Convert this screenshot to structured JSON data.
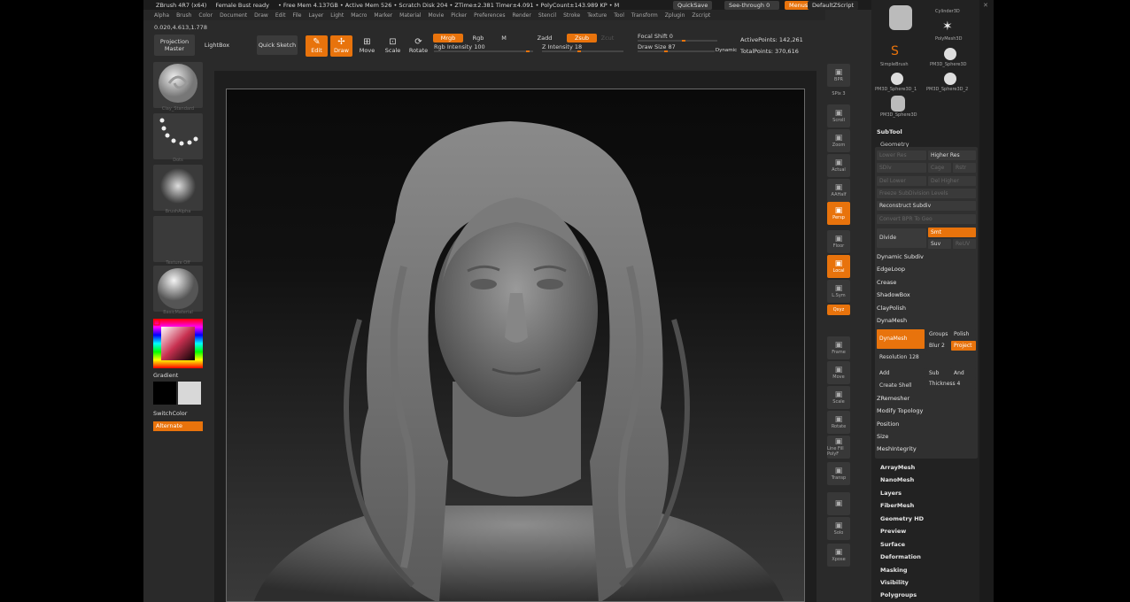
{
  "topbar": {
    "items": [
      "ZBrush 4R7 (x64)",
      "Female Bust ready",
      "• Free Mem 4.137GB • Active Mem 526 • Scratch Disk 204 • ZTime±2.381 Timer±4.091 • PolyCount±143.989 KP • M"
    ],
    "quicksave": "QuickSave",
    "seethrough": "See-through  0",
    "menus": "Menus",
    "script": "DefaultZScript"
  },
  "menubar": [
    "Alpha",
    "Brush",
    "Color",
    "Document",
    "Draw",
    "Edit",
    "File",
    "Layer",
    "Light",
    "Macro",
    "Marker",
    "Material",
    "Movie",
    "Picker",
    "Preferences",
    "Render",
    "Stencil",
    "Stroke",
    "Texture",
    "Tool",
    "Transform",
    "Zplugin",
    "Zscript"
  ],
  "coords": "0.020,4.613,1.778",
  "toolbar": {
    "projection_master": "Projection Master",
    "lightbox": "LightBox",
    "quick_sketch": "Quick Sketch",
    "edit": "Edit",
    "draw": "Draw",
    "move": "Move",
    "scale": "Scale",
    "rotate": "Rotate",
    "mrgb": "Mrgb",
    "rgb": "Rgb",
    "m": "M",
    "zadd": "Zadd",
    "zsub": "Zsub",
    "zcut": "Zcut",
    "rgb_intensity": "Rgb Intensity 100",
    "z_intensity": "Z Intensity 18",
    "focal_shift": "Focal Shift 0",
    "draw_size": "Draw Size 87",
    "dynamic": "Dynamic",
    "active_points": "ActivePoints: 142,261",
    "total_points": "TotalPoints: 370,616"
  },
  "leftshelf": {
    "brush_label": "Clay_Standard",
    "stroke_label": "Dots",
    "alpha_label": "BrushAlpha",
    "texture_label": "Texture Off",
    "material_label": "BasicMaterial",
    "gradient": "Gradient",
    "switchcolor": "SwitchColor",
    "alternate": "Alternate"
  },
  "rightshelf": [
    {
      "name": "bpr",
      "label": "BPR"
    },
    {
      "name": "spix",
      "label": "SPix 3"
    },
    {
      "name": "scroll",
      "label": "Scroll"
    },
    {
      "name": "zoom",
      "label": "Zoom"
    },
    {
      "name": "actual",
      "label": "Actual"
    },
    {
      "name": "aahalf",
      "label": "AAHalf"
    },
    {
      "name": "persp",
      "label": "Persp"
    },
    {
      "name": "floor",
      "label": "Floor"
    },
    {
      "name": "local",
      "label": "Local"
    },
    {
      "name": "lsym",
      "label": "L.Sym"
    },
    {
      "name": "xyz",
      "label": "Qxyz"
    },
    {
      "name": "frame",
      "label": "Frame"
    },
    {
      "name": "move",
      "label": "Move"
    },
    {
      "name": "scale",
      "label": "Scale"
    },
    {
      "name": "rotate",
      "label": "Rotate"
    },
    {
      "name": "linefill",
      "label": "Line Fill PolyF"
    },
    {
      "name": "transp",
      "label": "Transp"
    },
    {
      "name": "ghost",
      "label": ""
    },
    {
      "name": "solo",
      "label": "Solo"
    },
    {
      "name": "xpose",
      "label": "Xpose"
    }
  ],
  "panel": {
    "tool_thumbs": [
      "Cylinder3D",
      "PolyMesh3D",
      "SimpleBrush",
      "PM3D_Sphere3D",
      "PM3D_Sphere3D_1",
      "PM3D_Sphere3D_2",
      "PM3D_Sphere3D"
    ],
    "subtool": "SubTool",
    "geometry": "Geometry",
    "lower_res": "Lower Res",
    "higher_res": "Higher Res",
    "sdiv": "SDiv",
    "cage": "Cage",
    "rstr": "Rstr",
    "del_lower": "Del Lower",
    "del_higher": "Del Higher",
    "freeze": "Freeze SubDivision Levels",
    "reconstruct": "Reconstruct Subdiv",
    "convert": "Convert BPR To Geo",
    "divide": "Divide",
    "smt": "Smt",
    "suv": "Suv",
    "reuv": "ReUV",
    "dynamic_subdiv": "Dynamic Subdiv",
    "edgeloop": "EdgeLoop",
    "crease": "Crease",
    "shadowbox": "ShadowBox",
    "claypolish": "ClayPolish",
    "dynamesh_title": "DynaMesh",
    "dynamesh_btn": "DynaMesh",
    "groups": "Groups",
    "polish": "Polish",
    "blur": "Blur 2",
    "project": "Project",
    "resolution": "Resolution 128",
    "add": "Add",
    "sub": "Sub",
    "and": "And",
    "create_shell": "Create Shell",
    "thickness": "Thickness 4",
    "zremesher": "ZRemesher",
    "modify_topology": "Modify Topology",
    "position": "Position",
    "size": "Size",
    "meshintegrity": "MeshIntegrity",
    "arraymesh": "ArrayMesh",
    "nanomesh": "NanoMesh",
    "layers": "Layers",
    "fibermesh": "FiberMesh",
    "geometry_hd": "Geometry HD",
    "preview": "Preview",
    "surface": "Surface",
    "deformation": "Deformation",
    "masking": "Masking",
    "visibility": "Visibility",
    "polygroups": "Polygroups"
  },
  "colors": {
    "accent": "#e8730c",
    "bg": "#2a2a2a",
    "panel": "#222222"
  }
}
